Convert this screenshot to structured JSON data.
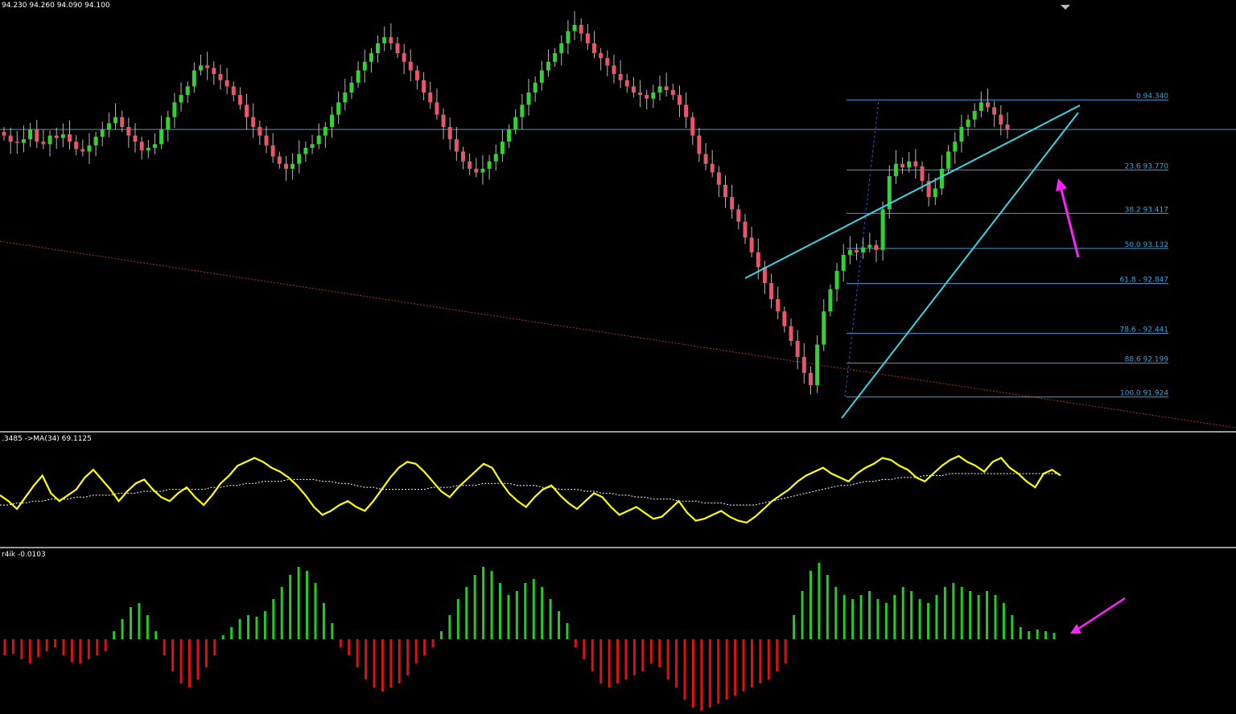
{
  "header": {
    "ohlc": "94.230 94.260 94.090 94.100",
    "osc_label": ".3485  ->MA(34) 69.1125",
    "hist_label": "r4ik -0.0103"
  },
  "colors": {
    "background": "#000000",
    "bull": "#32d232",
    "bear": "#e8566a",
    "wick": "#b8b8b8",
    "fib": "#3aa3e0",
    "trend": "#36d6e6",
    "arrow": "#ff22ff",
    "oscillator": "#ffff00",
    "osc_ma": "#ffffff",
    "hist_pos": "#22cc22",
    "hist_neg": "#dd1111",
    "downtrend": "#b03020"
  },
  "chart_data": [
    {
      "type": "candlestick",
      "ylim": [
        91.7,
        95.1
      ],
      "fib_levels": [
        {
          "label": "0 94.340",
          "value": 94.34
        },
        {
          "label": "23.6 93.770",
          "value": 93.77
        },
        {
          "label": "38.2 93.417",
          "value": 93.417
        },
        {
          "label": "50.0 93.132",
          "value": 93.132
        },
        {
          "label": "61.8 - 92.847",
          "value": 92.847
        },
        {
          "label": "78.6 - 92.441",
          "value": 92.441
        },
        {
          "label": "88.6 92.199",
          "value": 92.199
        },
        {
          "label": "100.0 91.924",
          "value": 91.924
        }
      ],
      "last_price": 94.1,
      "closes": [
        94.05,
        94.0,
        93.99,
        94.02,
        94.1,
        94.0,
        93.98,
        94.05,
        94.03,
        94.06,
        94.0,
        93.94,
        93.92,
        93.97,
        94.04,
        94.1,
        94.15,
        94.2,
        94.12,
        94.05,
        94.0,
        93.93,
        93.95,
        93.98,
        94.1,
        94.2,
        94.32,
        94.38,
        94.45,
        94.58,
        94.62,
        94.6,
        94.55,
        94.5,
        94.45,
        94.38,
        94.3,
        94.2,
        94.12,
        94.05,
        93.97,
        93.88,
        93.82,
        93.78,
        93.82,
        93.9,
        93.95,
        93.98,
        94.05,
        94.12,
        94.22,
        94.32,
        94.4,
        94.48,
        94.58,
        94.65,
        94.72,
        94.8,
        94.85,
        94.8,
        94.72,
        94.65,
        94.58,
        94.5,
        94.4,
        94.32,
        94.22,
        94.12,
        94.02,
        93.92,
        93.84,
        93.78,
        93.75,
        93.78,
        93.84,
        93.9,
        94.0,
        94.1,
        94.2,
        94.3,
        94.4,
        94.48,
        94.58,
        94.65,
        94.72,
        94.8,
        94.9,
        94.95,
        94.88,
        94.8,
        94.72,
        94.68,
        94.62,
        94.55,
        94.5,
        94.45,
        94.4,
        94.38,
        94.35,
        94.4,
        94.45,
        94.42,
        94.38,
        94.3,
        94.2,
        94.05,
        93.9,
        93.82,
        93.75,
        93.65,
        93.55,
        93.45,
        93.35,
        93.22,
        93.1,
        92.98,
        92.85,
        92.72,
        92.62,
        92.5,
        92.38,
        92.25,
        92.12,
        92.02,
        92.35,
        92.62,
        92.8,
        92.95,
        93.08,
        93.12,
        93.1,
        93.14,
        93.16,
        93.12,
        93.45,
        93.72,
        93.82,
        93.79,
        93.84,
        93.8,
        93.68,
        93.55,
        93.62,
        93.78,
        93.92,
        94.0,
        94.12,
        94.18,
        94.25,
        94.32,
        94.28,
        94.22,
        94.14,
        94.1
      ]
    },
    {
      "type": "line",
      "series": [
        {
          "values": [
            63,
            60,
            56,
            62,
            68,
            73,
            64,
            60,
            63,
            66,
            72,
            76,
            71,
            66,
            60,
            65,
            69,
            71,
            66,
            62,
            60,
            64,
            67,
            62,
            58,
            63,
            69,
            73,
            78,
            80,
            82,
            80,
            77,
            75,
            72,
            68,
            63,
            57,
            53,
            55,
            58,
            60,
            57,
            55,
            60,
            66,
            72,
            77,
            80,
            79,
            75,
            70,
            65,
            62,
            67,
            71,
            75,
            79,
            77,
            70,
            64,
            60,
            57,
            62,
            66,
            68,
            63,
            59,
            56,
            60,
            64,
            62,
            57,
            53,
            55,
            57,
            54,
            51,
            52,
            56,
            60,
            54,
            50,
            51,
            53,
            55,
            52,
            50,
            49,
            52,
            56,
            60,
            63,
            66,
            70,
            73,
            75,
            77,
            74,
            72,
            70,
            74,
            77,
            79,
            82,
            81,
            78,
            76,
            72,
            70,
            74,
            78,
            81,
            83,
            80,
            78,
            75,
            80,
            82,
            77,
            74,
            70,
            67,
            74,
            76,
            73
          ]
        },
        {
          "values": [
            58,
            58,
            59,
            59,
            60,
            60,
            61,
            61,
            61,
            62,
            62,
            63,
            63,
            63,
            64,
            64,
            64,
            65,
            65,
            65,
            66,
            66,
            66,
            66,
            66,
            67,
            67,
            68,
            68,
            69,
            69,
            70,
            70,
            70,
            71,
            71,
            71,
            71,
            70,
            70,
            69,
            69,
            68,
            67,
            67,
            66,
            66,
            66,
            66,
            66,
            66,
            67,
            67,
            67,
            68,
            68,
            68,
            69,
            69,
            69,
            69,
            68,
            68,
            68,
            67,
            67,
            66,
            66,
            66,
            65,
            65,
            64,
            64,
            63,
            63,
            62,
            62,
            61,
            61,
            61,
            60,
            60,
            60,
            59,
            59,
            59,
            58,
            58,
            58,
            58,
            59,
            60,
            61,
            62,
            63,
            64,
            65,
            66,
            67,
            68,
            68,
            69,
            70,
            70,
            71,
            71,
            72,
            72,
            72,
            73,
            73,
            73,
            74,
            74,
            74,
            74,
            74,
            74,
            74,
            74,
            74,
            74,
            74,
            74,
            74,
            74
          ]
        }
      ]
    },
    {
      "type": "bar",
      "values": [
        -0.02,
        -0.018,
        -0.025,
        -0.03,
        -0.022,
        -0.015,
        -0.01,
        -0.02,
        -0.028,
        -0.03,
        -0.025,
        -0.02,
        -0.015,
        0.01,
        0.025,
        0.04,
        0.045,
        0.03,
        0.01,
        -0.02,
        -0.04,
        -0.055,
        -0.06,
        -0.05,
        -0.035,
        -0.02,
        0.005,
        0.015,
        0.025,
        0.03,
        0.028,
        0.035,
        0.05,
        0.065,
        0.08,
        0.09,
        0.085,
        0.07,
        0.045,
        0.02,
        -0.01,
        -0.02,
        -0.035,
        -0.05,
        -0.06,
        -0.065,
        -0.06,
        -0.055,
        -0.045,
        -0.03,
        -0.02,
        -0.01,
        0.01,
        0.03,
        0.05,
        0.065,
        0.08,
        0.09,
        0.085,
        0.07,
        0.055,
        0.06,
        0.07,
        0.075,
        0.065,
        0.05,
        0.035,
        0.02,
        -0.01,
        -0.025,
        -0.04,
        -0.055,
        -0.06,
        -0.055,
        -0.05,
        -0.045,
        -0.04,
        -0.03,
        -0.035,
        -0.05,
        -0.06,
        -0.075,
        -0.085,
        -0.09,
        -0.085,
        -0.08,
        -0.075,
        -0.07,
        -0.065,
        -0.06,
        -0.055,
        -0.05,
        -0.04,
        -0.03,
        0.03,
        0.06,
        0.085,
        0.095,
        0.08,
        0.065,
        0.055,
        0.05,
        0.055,
        0.06,
        0.05,
        0.045,
        0.055,
        0.065,
        0.06,
        0.05,
        0.045,
        0.055,
        0.065,
        0.07,
        0.065,
        0.06,
        0.055,
        0.06,
        0.055,
        0.045,
        0.03,
        0.015,
        0.01,
        0.012,
        0.01,
        0.008
      ]
    }
  ]
}
